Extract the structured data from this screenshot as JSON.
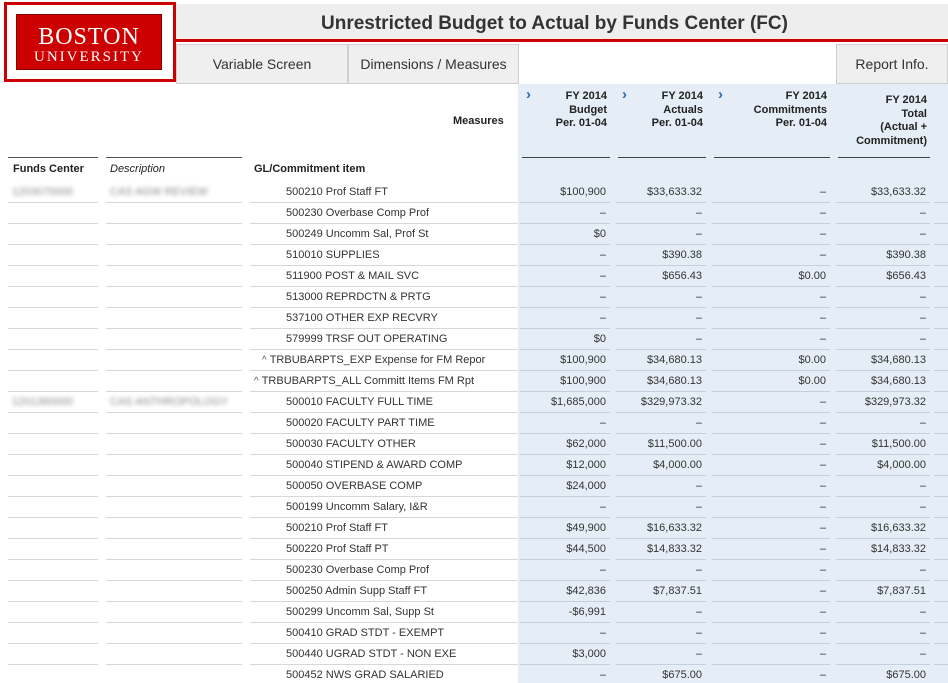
{
  "logo": {
    "line1": "BOSTON",
    "line2": "UNIVERSITY"
  },
  "title": "Unrestricted Budget to Actual by Funds Center (FC)",
  "nav": {
    "variable_screen": "Variable Screen",
    "dimensions_measures": "Dimensions / Measures",
    "report_info": "Report Info."
  },
  "measures_label": "Measures",
  "measures": [
    {
      "lines": [
        "FY 2014",
        "Budget",
        "Per. 01-04"
      ]
    },
    {
      "lines": [
        "FY 2014",
        "Actuals",
        "Per. 01-04"
      ]
    },
    {
      "lines": [
        "FY 2014",
        "Commitments",
        "Per. 01-04"
      ]
    },
    {
      "lines": [
        "FY 2014",
        "Total",
        "(Actual +",
        "Commitment)"
      ]
    }
  ],
  "columns": {
    "funds_center": "Funds Center",
    "description": "Description",
    "gl_item": "GL/Commitment item"
  },
  "rows": [
    {
      "fc": "1203070000",
      "desc": "CAS AGW REVIEW",
      "gl": "500210 Prof Staff FT",
      "vals": [
        "$100,900",
        "$33,633.32",
        "–",
        "$33,633.32"
      ]
    },
    {
      "fc": "",
      "desc": "",
      "gl": "500230 Overbase Comp Prof",
      "vals": [
        "–",
        "–",
        "–",
        "–"
      ]
    },
    {
      "fc": "",
      "desc": "",
      "gl": "500249 Uncomm Sal, Prof St",
      "vals": [
        "$0",
        "–",
        "–",
        "–"
      ]
    },
    {
      "fc": "",
      "desc": "",
      "gl": "510010 SUPPLIES",
      "vals": [
        "–",
        "$390.38",
        "–",
        "$390.38"
      ]
    },
    {
      "fc": "",
      "desc": "",
      "gl": "511900 POST & MAIL SVC",
      "vals": [
        "–",
        "$656.43",
        "$0.00",
        "$656.43"
      ]
    },
    {
      "fc": "",
      "desc": "",
      "gl": "513000 REPRDCTN & PRTG",
      "vals": [
        "–",
        "–",
        "–",
        "–"
      ]
    },
    {
      "fc": "",
      "desc": "",
      "gl": "537100 OTHER EXP RECVRY",
      "vals": [
        "–",
        "–",
        "–",
        "–"
      ]
    },
    {
      "fc": "",
      "desc": "",
      "gl": "579999 TRSF OUT OPERATING",
      "vals": [
        "$0",
        "–",
        "–",
        "–"
      ]
    },
    {
      "fc": "",
      "desc": "",
      "gl": "TRBUBARPTS_EXP Expense for FM Repor",
      "node": true,
      "indent": 1,
      "vals": [
        "$100,900",
        "$34,680.13",
        "$0.00",
        "$34,680.13"
      ]
    },
    {
      "fc": "",
      "desc": "",
      "gl": "TRBUBARPTS_ALL Committ Items FM Rpt",
      "node": true,
      "indent": 0,
      "vals": [
        "$100,900",
        "$34,680.13",
        "$0.00",
        "$34,680.13"
      ]
    },
    {
      "fc": "1201360000",
      "desc": "CAS ANTHROPOLOGY",
      "gl": "500010 FACULTY FULL TIME",
      "vals": [
        "$1,685,000",
        "$329,973.32",
        "–",
        "$329,973.32"
      ]
    },
    {
      "fc": "",
      "desc": "",
      "gl": "500020 FACULTY PART TIME",
      "vals": [
        "–",
        "–",
        "–",
        "–"
      ]
    },
    {
      "fc": "",
      "desc": "",
      "gl": "500030 FACULTY OTHER",
      "vals": [
        "$62,000",
        "$11,500.00",
        "–",
        "$11,500.00"
      ]
    },
    {
      "fc": "",
      "desc": "",
      "gl": "500040 STIPEND & AWARD COMP",
      "vals": [
        "$12,000",
        "$4,000.00",
        "–",
        "$4,000.00"
      ]
    },
    {
      "fc": "",
      "desc": "",
      "gl": "500050 OVERBASE COMP",
      "vals": [
        "$24,000",
        "–",
        "–",
        "–"
      ]
    },
    {
      "fc": "",
      "desc": "",
      "gl": "500199 Uncomm Salary, I&R",
      "vals": [
        "–",
        "–",
        "–",
        "–"
      ]
    },
    {
      "fc": "",
      "desc": "",
      "gl": "500210 Prof Staff FT",
      "vals": [
        "$49,900",
        "$16,633.32",
        "–",
        "$16,633.32"
      ]
    },
    {
      "fc": "",
      "desc": "",
      "gl": "500220 Prof Staff PT",
      "vals": [
        "$44,500",
        "$14,833.32",
        "–",
        "$14,833.32"
      ]
    },
    {
      "fc": "",
      "desc": "",
      "gl": "500230 Overbase Comp Prof",
      "vals": [
        "–",
        "–",
        "–",
        "–"
      ]
    },
    {
      "fc": "",
      "desc": "",
      "gl": "500250 Admin Supp Staff FT",
      "vals": [
        "$42,836",
        "$7,837.51",
        "–",
        "$7,837.51"
      ]
    },
    {
      "fc": "",
      "desc": "",
      "gl": "500299 Uncomm Sal, Supp St",
      "vals": [
        "-$6,991",
        "–",
        "–",
        "–"
      ]
    },
    {
      "fc": "",
      "desc": "",
      "gl": "500410 GRAD STDT - EXEMPT",
      "vals": [
        "–",
        "–",
        "–",
        "–"
      ]
    },
    {
      "fc": "",
      "desc": "",
      "gl": "500440 UGRAD STDT - NON EXE",
      "vals": [
        "$3,000",
        "–",
        "–",
        "–"
      ]
    },
    {
      "fc": "",
      "desc": "",
      "gl": "500452 NWS GRAD SALARIED",
      "vals": [
        "–",
        "$675.00",
        "–",
        "$675.00"
      ]
    }
  ]
}
